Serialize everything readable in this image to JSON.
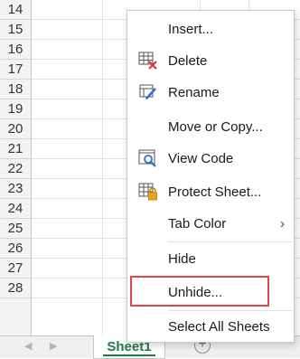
{
  "grid": {
    "rows": [
      "14",
      "15",
      "16",
      "17",
      "18",
      "19",
      "20",
      "21",
      "22",
      "23",
      "24",
      "25",
      "26",
      "27",
      "28"
    ]
  },
  "tabbar": {
    "nav_prev": "◀",
    "nav_next": "▶",
    "sheet_tab": "Sheet1",
    "add_sheet": "+"
  },
  "menu": {
    "insert": "Insert...",
    "delete": "Delete",
    "rename": "Rename",
    "move_copy": "Move or Copy...",
    "view_code": "View Code",
    "protect_sheet": "Protect Sheet...",
    "tab_color": "Tab Color",
    "tab_color_arrow": "›",
    "hide": "Hide",
    "unhide": "Unhide...",
    "select_all": "Select All Sheets"
  },
  "icons": {
    "delete": "delete-sheet-icon",
    "rename": "rename-sheet-icon",
    "view_code": "view-code-icon",
    "protect_sheet": "protect-sheet-icon"
  },
  "colors": {
    "sheet_tab_green": "#1f7a45",
    "highlight_red": "#e0474c"
  }
}
